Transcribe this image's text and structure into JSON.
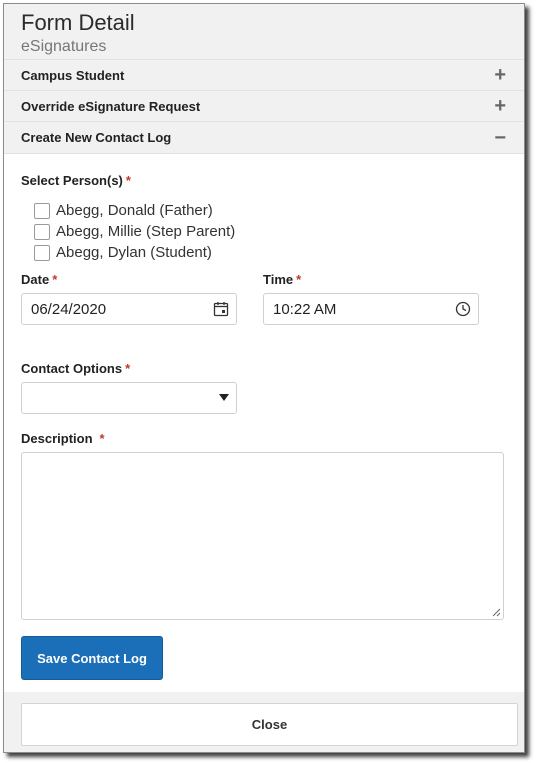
{
  "header": {
    "title": "Form Detail",
    "subtitle": "eSignatures"
  },
  "sections": [
    {
      "label": "Campus Student",
      "toggle": "+"
    },
    {
      "label": "Override eSignature Request",
      "toggle": "+"
    },
    {
      "label": "Create New Contact Log",
      "toggle": "−"
    }
  ],
  "form": {
    "persons_label": "Select Person(s)",
    "required_mark": "*",
    "persons": [
      {
        "label": "Abegg, Donald (Father)",
        "checked": false
      },
      {
        "label": "Abegg, Millie (Step Parent)",
        "checked": false
      },
      {
        "label": "Abegg, Dylan (Student)",
        "checked": false
      }
    ],
    "date_label": "Date",
    "date_value": "06/24/2020",
    "time_label": "Time",
    "time_value": "10:22 AM",
    "contact_options_label": "Contact Options",
    "contact_options_value": "",
    "description_label": "Description",
    "description_value": "",
    "save_button": "Save Contact Log"
  },
  "footer": {
    "close_button": "Close"
  },
  "colors": {
    "primary": "#1b6eb8",
    "required": "#c0392b",
    "panel": "#f1f1f1"
  },
  "icons": {
    "date": "calendar-icon",
    "time": "clock-icon",
    "select": "caret-down-icon"
  }
}
